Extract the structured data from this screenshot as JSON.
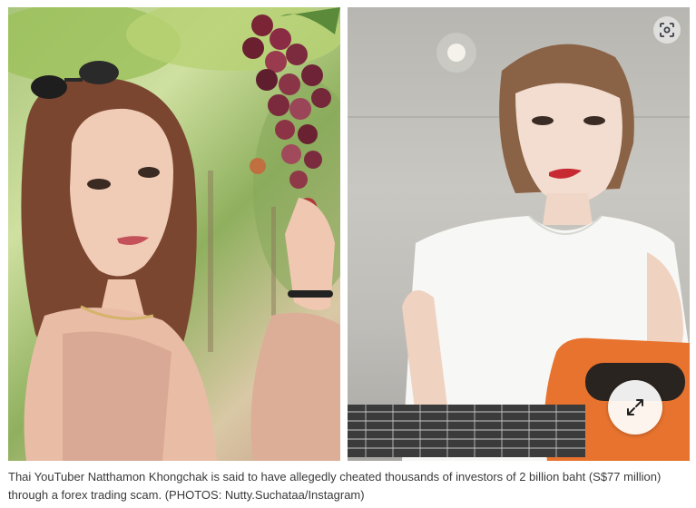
{
  "images": {
    "left_alt_icon": "photo-woman-grapes",
    "right_alt_icon": "photo-woman-guitar",
    "scan_icon": "lens-scan-icon",
    "expand_icon": "expand-arrows-icon"
  },
  "caption": {
    "text": "Thai YouTuber Natthamon Khongchak is said to have allegedly cheated thousands of investors of 2 billion baht (S$77 million) through a forex trading scam. (PHOTOS: Nutty.Suchataa/Instagram)"
  },
  "colors": {
    "caption_text": "#3a3a3a",
    "guitar": "#e8732e"
  }
}
